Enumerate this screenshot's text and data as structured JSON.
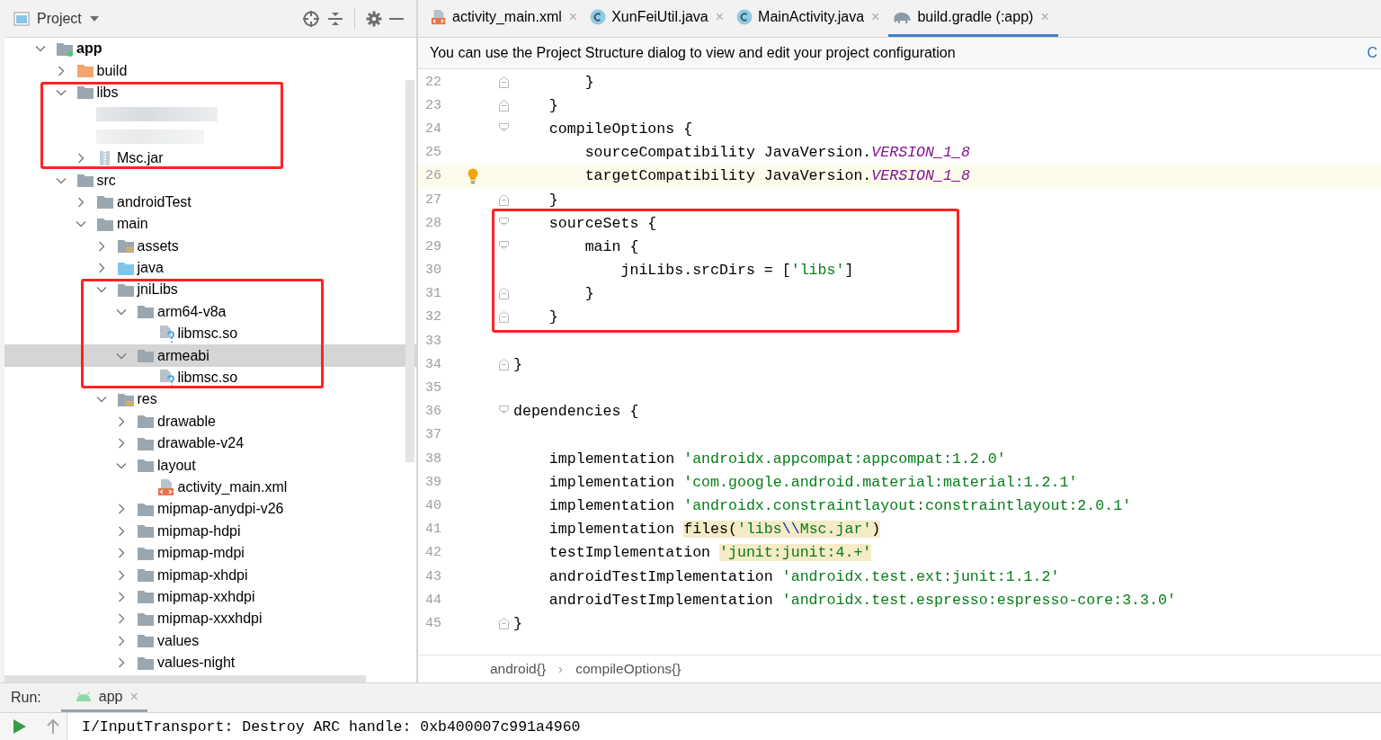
{
  "project_panel": {
    "title": "Project"
  },
  "tree": {
    "items": [
      {
        "label": "app",
        "kind": "module",
        "expanded": true,
        "selected": false,
        "children": [
          {
            "label": "build",
            "kind": "excluded-folder",
            "expanded": false,
            "selected": false
          },
          {
            "label": "libs",
            "kind": "folder",
            "expanded": true,
            "selected": false,
            "annotated": true,
            "children": [
              {
                "kind": "blurred"
              },
              {
                "kind": "blurred"
              },
              {
                "label": "Msc.jar",
                "kind": "jar",
                "expanded": false,
                "selected": false
              }
            ]
          },
          {
            "label": "src",
            "kind": "folder",
            "expanded": true,
            "selected": false,
            "children": [
              {
                "label": "androidTest",
                "kind": "folder",
                "expanded": false,
                "selected": false
              },
              {
                "label": "main",
                "kind": "folder",
                "expanded": true,
                "selected": false,
                "children": [
                  {
                    "label": "assets",
                    "kind": "resource-folder",
                    "expanded": false,
                    "selected": false
                  },
                  {
                    "label": "java",
                    "kind": "source-folder",
                    "expanded": false,
                    "selected": false
                  },
                  {
                    "label": "jniLibs",
                    "kind": "folder",
                    "expanded": true,
                    "selected": false,
                    "annotated": true,
                    "children": [
                      {
                        "label": "arm64-v8a",
                        "kind": "folder",
                        "expanded": true,
                        "selected": false,
                        "children": [
                          {
                            "label": "libmsc.so",
                            "kind": "unknown-file",
                            "selected": false
                          }
                        ]
                      },
                      {
                        "label": "armeabi",
                        "kind": "folder",
                        "expanded": true,
                        "selected": true,
                        "children": [
                          {
                            "label": "libmsc.so",
                            "kind": "unknown-file",
                            "selected": false
                          }
                        ]
                      }
                    ]
                  },
                  {
                    "label": "res",
                    "kind": "resource-folder",
                    "expanded": true,
                    "selected": false,
                    "children": [
                      {
                        "label": "drawable",
                        "kind": "folder",
                        "expanded": false,
                        "selected": false
                      },
                      {
                        "label": "drawable-v24",
                        "kind": "folder",
                        "expanded": false,
                        "selected": false
                      },
                      {
                        "label": "layout",
                        "kind": "folder",
                        "expanded": true,
                        "selected": false,
                        "children": [
                          {
                            "label": "activity_main.xml",
                            "kind": "xml-file",
                            "selected": false
                          }
                        ]
                      },
                      {
                        "label": "mipmap-anydpi-v26",
                        "kind": "folder",
                        "expanded": false,
                        "selected": false
                      },
                      {
                        "label": "mipmap-hdpi",
                        "kind": "folder",
                        "expanded": false,
                        "selected": false
                      },
                      {
                        "label": "mipmap-mdpi",
                        "kind": "folder",
                        "expanded": false,
                        "selected": false
                      },
                      {
                        "label": "mipmap-xhdpi",
                        "kind": "folder",
                        "expanded": false,
                        "selected": false
                      },
                      {
                        "label": "mipmap-xxhdpi",
                        "kind": "folder",
                        "expanded": false,
                        "selected": false
                      },
                      {
                        "label": "mipmap-xxxhdpi",
                        "kind": "folder",
                        "expanded": false,
                        "selected": false
                      },
                      {
                        "label": "values",
                        "kind": "folder",
                        "expanded": false,
                        "selected": false
                      },
                      {
                        "label": "values-night",
                        "kind": "folder",
                        "expanded": false,
                        "selected": false
                      }
                    ]
                  }
                ]
              }
            ]
          }
        ]
      }
    ]
  },
  "tabs": [
    {
      "label": "activity_main.xml",
      "kind": "xml",
      "selected": false,
      "close": "×"
    },
    {
      "label": "XunFeiUtil.java",
      "kind": "class",
      "selected": false,
      "close": "×"
    },
    {
      "label": "MainActivity.java",
      "kind": "class",
      "selected": false,
      "close": "×"
    },
    {
      "label": "build.gradle (:app)",
      "kind": "gradle",
      "selected": true,
      "close": "×"
    }
  ],
  "notification": {
    "text": "You can use the Project Structure dialog to view and edit your project configuration",
    "link": "C"
  },
  "code_blocks": [
    {
      "lines": [
        {
          "number": "22",
          "fold_start": false,
          "fold_end": true,
          "current": false,
          "tokens": [
            {
              "text": "        }",
              "kind": "plain"
            }
          ]
        },
        {
          "number": "23",
          "fold_start": false,
          "fold_end": true,
          "current": false,
          "tokens": [
            {
              "text": "    }",
              "kind": "plain"
            }
          ]
        },
        {
          "number": "24",
          "fold_start": true,
          "fold_end": false,
          "current": false,
          "tokens": [
            {
              "text": "    compileOptions {",
              "kind": "plain"
            }
          ]
        },
        {
          "number": "25",
          "fold_start": false,
          "fold_end": false,
          "current": false,
          "tokens": [
            {
              "text": "        sourceCompatibility JavaVersion.",
              "kind": "plain"
            },
            {
              "text": "VERSION_1_8",
              "kind": "constant"
            }
          ]
        },
        {
          "number": "26",
          "fold_start": false,
          "fold_end": false,
          "current": true,
          "tokens": [
            {
              "text": "        targetCompatibility JavaVersion.",
              "kind": "plain"
            },
            {
              "text": "VERSION_1_8",
              "kind": "constant"
            }
          ]
        },
        {
          "number": "27",
          "fold_start": false,
          "fold_end": true,
          "current": false,
          "tokens": [
            {
              "text": "    }",
              "kind": "plain"
            }
          ]
        }
      ]
    },
    {
      "annotated": true,
      "lines": [
        {
          "number": "28",
          "fold_start": true,
          "fold_end": false,
          "current": false,
          "tokens": [
            {
              "text": "    sourceSets {",
              "kind": "plain"
            }
          ]
        },
        {
          "number": "29",
          "fold_start": true,
          "fold_end": false,
          "current": false,
          "tokens": [
            {
              "text": "        main {",
              "kind": "plain"
            }
          ]
        },
        {
          "number": "30",
          "fold_start": false,
          "fold_end": false,
          "current": false,
          "tokens": [
            {
              "text": "            jniLibs.srcDirs = [",
              "kind": "plain"
            },
            {
              "text": "'libs'",
              "kind": "string"
            },
            {
              "text": "]",
              "kind": "plain"
            }
          ]
        },
        {
          "number": "31",
          "fold_start": false,
          "fold_end": true,
          "current": false,
          "tokens": [
            {
              "text": "        }",
              "kind": "plain"
            }
          ]
        },
        {
          "number": "32",
          "fold_start": false,
          "fold_end": true,
          "current": false,
          "tokens": [
            {
              "text": "    }",
              "kind": "plain"
            }
          ]
        }
      ]
    },
    {
      "lines": [
        {
          "number": "33",
          "fold_start": false,
          "fold_end": false,
          "current": false
        },
        {
          "number": "34",
          "fold_start": false,
          "fold_end": true,
          "current": false,
          "tokens": [
            {
              "text": "}",
              "kind": "plain"
            }
          ]
        },
        {
          "number": "35",
          "fold_start": false,
          "fold_end": false,
          "current": false
        },
        {
          "number": "36",
          "fold_start": true,
          "fold_end": false,
          "current": false,
          "tokens": [
            {
              "text": "dependencies {",
              "kind": "plain"
            }
          ]
        },
        {
          "number": "37",
          "fold_start": false,
          "fold_end": false,
          "current": false
        },
        {
          "number": "38",
          "fold_start": false,
          "fold_end": false,
          "current": false,
          "tokens": [
            {
              "text": "    implementation ",
              "kind": "plain"
            },
            {
              "text": "'androidx.appcompat:appcompat:1.2.0'",
              "kind": "string"
            }
          ]
        },
        {
          "number": "39",
          "fold_start": false,
          "fold_end": false,
          "current": false,
          "tokens": [
            {
              "text": "    implementation ",
              "kind": "plain"
            },
            {
              "text": "'com.google.android.material:material:1.2.1'",
              "kind": "string"
            }
          ]
        },
        {
          "number": "40",
          "fold_start": false,
          "fold_end": false,
          "current": false,
          "tokens": [
            {
              "text": "    implementation ",
              "kind": "plain"
            },
            {
              "text": "'androidx.constraintlayout:constraintlayout:2.0.1'",
              "kind": "string"
            }
          ]
        },
        {
          "number": "41",
          "fold_start": false,
          "fold_end": false,
          "current": false,
          "tokens": [
            {
              "text": "    implementation ",
              "kind": "plain"
            },
            {
              "text": "files(",
              "kind": "marked"
            },
            {
              "text": "'libs",
              "kind": "marked-string"
            },
            {
              "text": "\\\\",
              "kind": "marked-escape"
            },
            {
              "text": "Msc.jar'",
              "kind": "marked-string"
            },
            {
              "text": ")",
              "kind": "marked"
            }
          ]
        },
        {
          "number": "42",
          "fold_start": false,
          "fold_end": false,
          "current": false,
          "tokens": [
            {
              "text": "    testImplementation ",
              "kind": "plain"
            },
            {
              "text": "'junit:junit:4.+'",
              "kind": "marked-string"
            }
          ]
        },
        {
          "number": "43",
          "fold_start": false,
          "fold_end": false,
          "current": false,
          "tokens": [
            {
              "text": "    androidTestImplementation ",
              "kind": "plain"
            },
            {
              "text": "'androidx.test.ext:junit:1.1.2'",
              "kind": "string"
            }
          ]
        },
        {
          "number": "44",
          "fold_start": false,
          "fold_end": false,
          "current": false,
          "tokens": [
            {
              "text": "    androidTestImplementation ",
              "kind": "plain"
            },
            {
              "text": "'androidx.test.espresso:espresso-core:3.3.0'",
              "kind": "string"
            }
          ]
        },
        {
          "number": "45",
          "fold_start": false,
          "fold_end": true,
          "current": false,
          "tokens": [
            {
              "text": "}",
              "kind": "plain"
            }
          ]
        }
      ]
    }
  ],
  "breadcrumbs": [
    {
      "label": "android{}"
    },
    {
      "label": "compileOptions{}"
    }
  ],
  "breadcrumb_separator": "›",
  "run_bar": {
    "label": "Run:",
    "tab": "app",
    "close": "×"
  },
  "console": {
    "line": "I/InputTransport: Destroy ARC handle: 0xb400007c991a4960"
  }
}
